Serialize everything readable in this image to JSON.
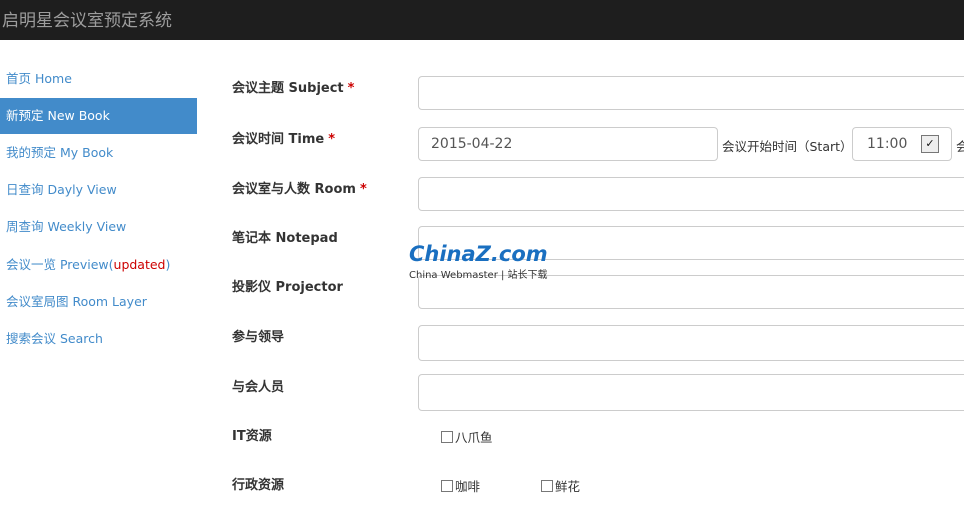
{
  "header": {
    "title": "启明星会议室预定系统"
  },
  "sidebar": {
    "items": [
      {
        "label": "首页 Home"
      },
      {
        "label": "新预定 New Book",
        "active": true
      },
      {
        "label": "我的预定 My Book"
      },
      {
        "label": "日查询 Dayly View"
      },
      {
        "label": "周查询 Weekly View"
      },
      {
        "label": "会议一览 Preview(",
        "badge": "updated",
        "suffix": ")"
      },
      {
        "label": "会议室局图 Room Layer"
      },
      {
        "label": "搜索会议 Search"
      }
    ]
  },
  "form": {
    "required_mark": "*",
    "subject_label": "会议主题 Subject",
    "time_label": "会议时间 Time",
    "date_value": "2015-04-22",
    "start_label": "会议开始时间（Start）",
    "start_value": "11:00",
    "cut_label": "会",
    "room_label": "会议室与人数 Room",
    "notepad_label": "笔记本 Notepad",
    "projector_label": "投影仪 Projector",
    "leaders_label": "参与领导",
    "attendees_label": "与会人员",
    "it_label": "IT资源",
    "it_options": [
      "八爪鱼"
    ],
    "admin_label": "行政资源",
    "admin_options": [
      "咖啡",
      "鲜花"
    ]
  },
  "watermark": {
    "logo": "ChinaZ.com",
    "tagline": "China Webmaster | 站长下载"
  },
  "colors": {
    "accent": "#428bca",
    "header": "#1e1e1e",
    "required": "#cc0000"
  }
}
